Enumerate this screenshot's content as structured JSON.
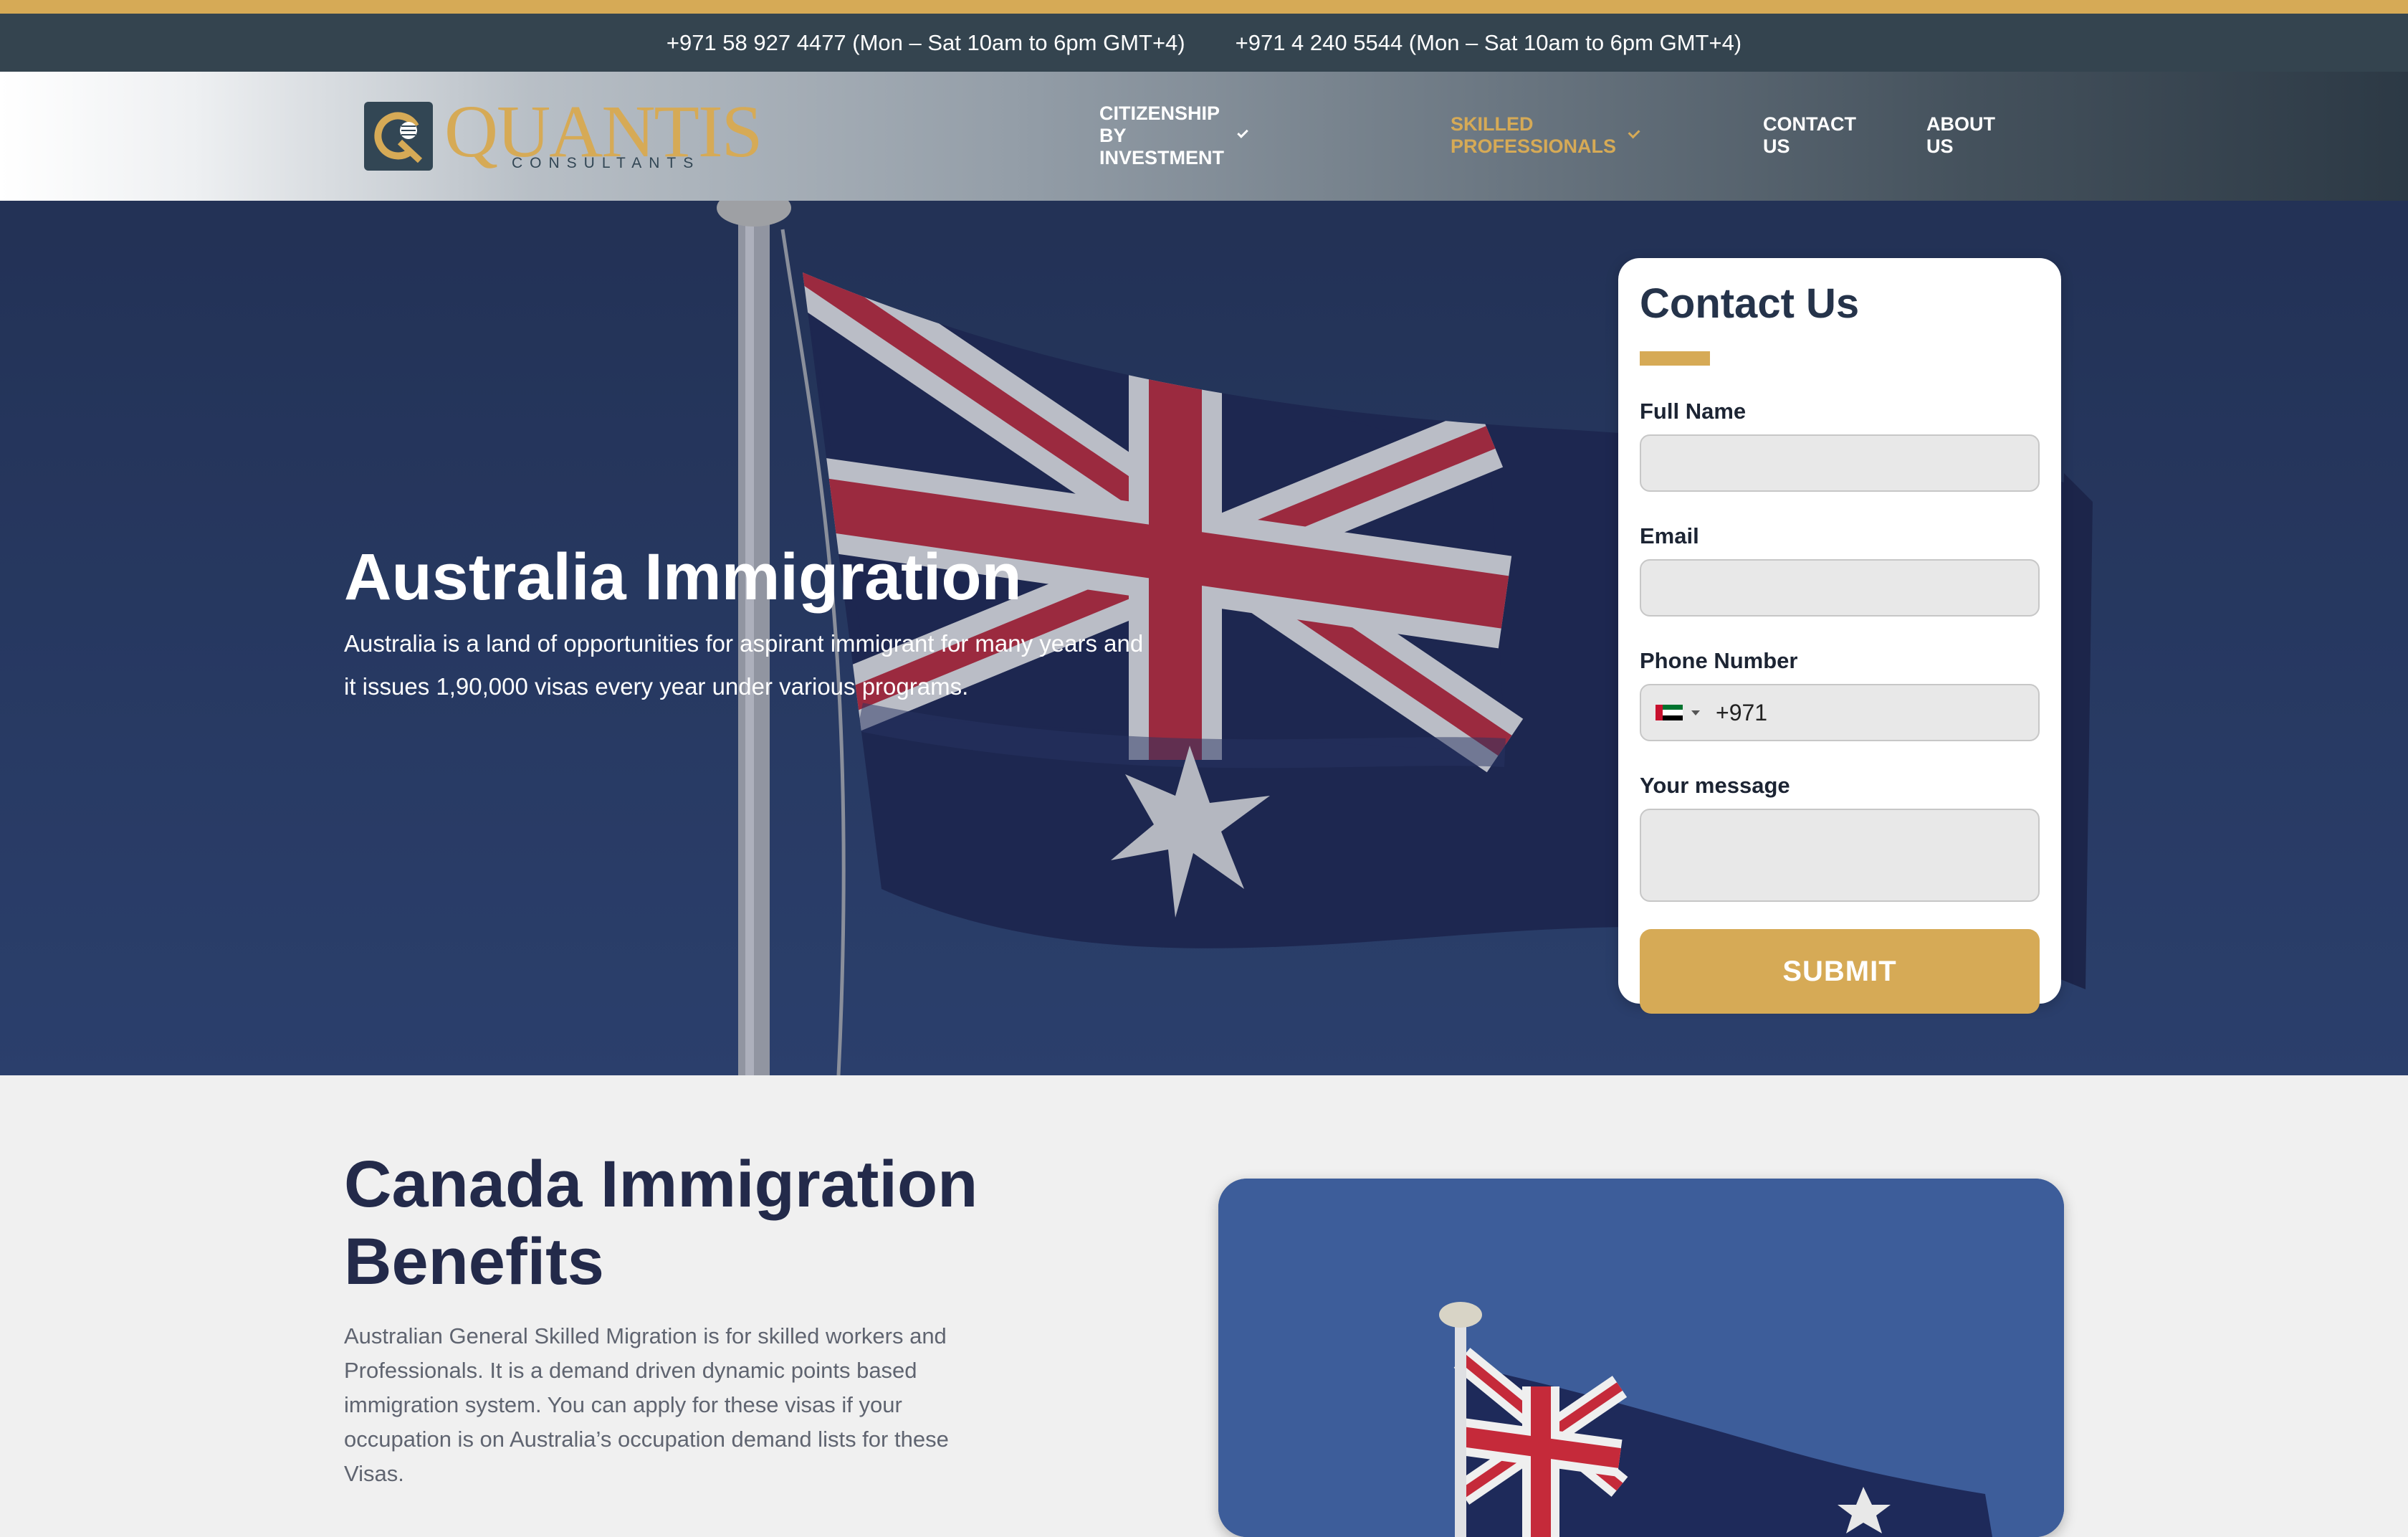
{
  "topbar": {
    "phone1": "+971 58 927 4477 (Mon – Sat 10am to 6pm GMT+4)",
    "phone2": "+971 4 240 5544 (Mon – Sat 10am to 6pm GMT+4)"
  },
  "brand": {
    "name": "QUANTIS",
    "tagline": "CONSULTANTS",
    "gold": "#d6aa56",
    "navy": "#324654"
  },
  "nav": {
    "items": [
      {
        "label": "CITIZENSHIP BY INVESTMENT",
        "has_dropdown": true,
        "active": false
      },
      {
        "label": "SKILLED PROFESSIONALS",
        "has_dropdown": true,
        "active": true
      },
      {
        "label": "CONTACT US",
        "has_dropdown": false,
        "active": false
      },
      {
        "label": "ABOUT US",
        "has_dropdown": false,
        "active": false
      }
    ]
  },
  "hero": {
    "title": "Australia Immigration",
    "subtitle_line1": "Australia is a land of opportunities for aspirant immigrant for many years and",
    "subtitle_line2": "it issues 1,90,000 visas every year under various programs.",
    "image": "australia-flag-photo"
  },
  "contact_form": {
    "title": "Contact Us",
    "fields": {
      "full_name": {
        "label": "Full Name",
        "value": ""
      },
      "email": {
        "label": "Email",
        "value": ""
      },
      "phone": {
        "label": "Phone Number",
        "country_flag": "uae-flag-icon",
        "value": "+971"
      },
      "message": {
        "label": "Your message",
        "value": ""
      }
    },
    "submit_label": "SUBMIT"
  },
  "section2": {
    "title_line1": "Canada Immigration",
    "title_line2": "Benefits",
    "body": "Australian General Skilled Migration is for skilled workers and Professionals. It is a demand driven dynamic points based immigration system. You can apply for these visas if your occupation is on Australia’s occupation demand lists for these Visas.",
    "image": "australia-flag-photo"
  }
}
